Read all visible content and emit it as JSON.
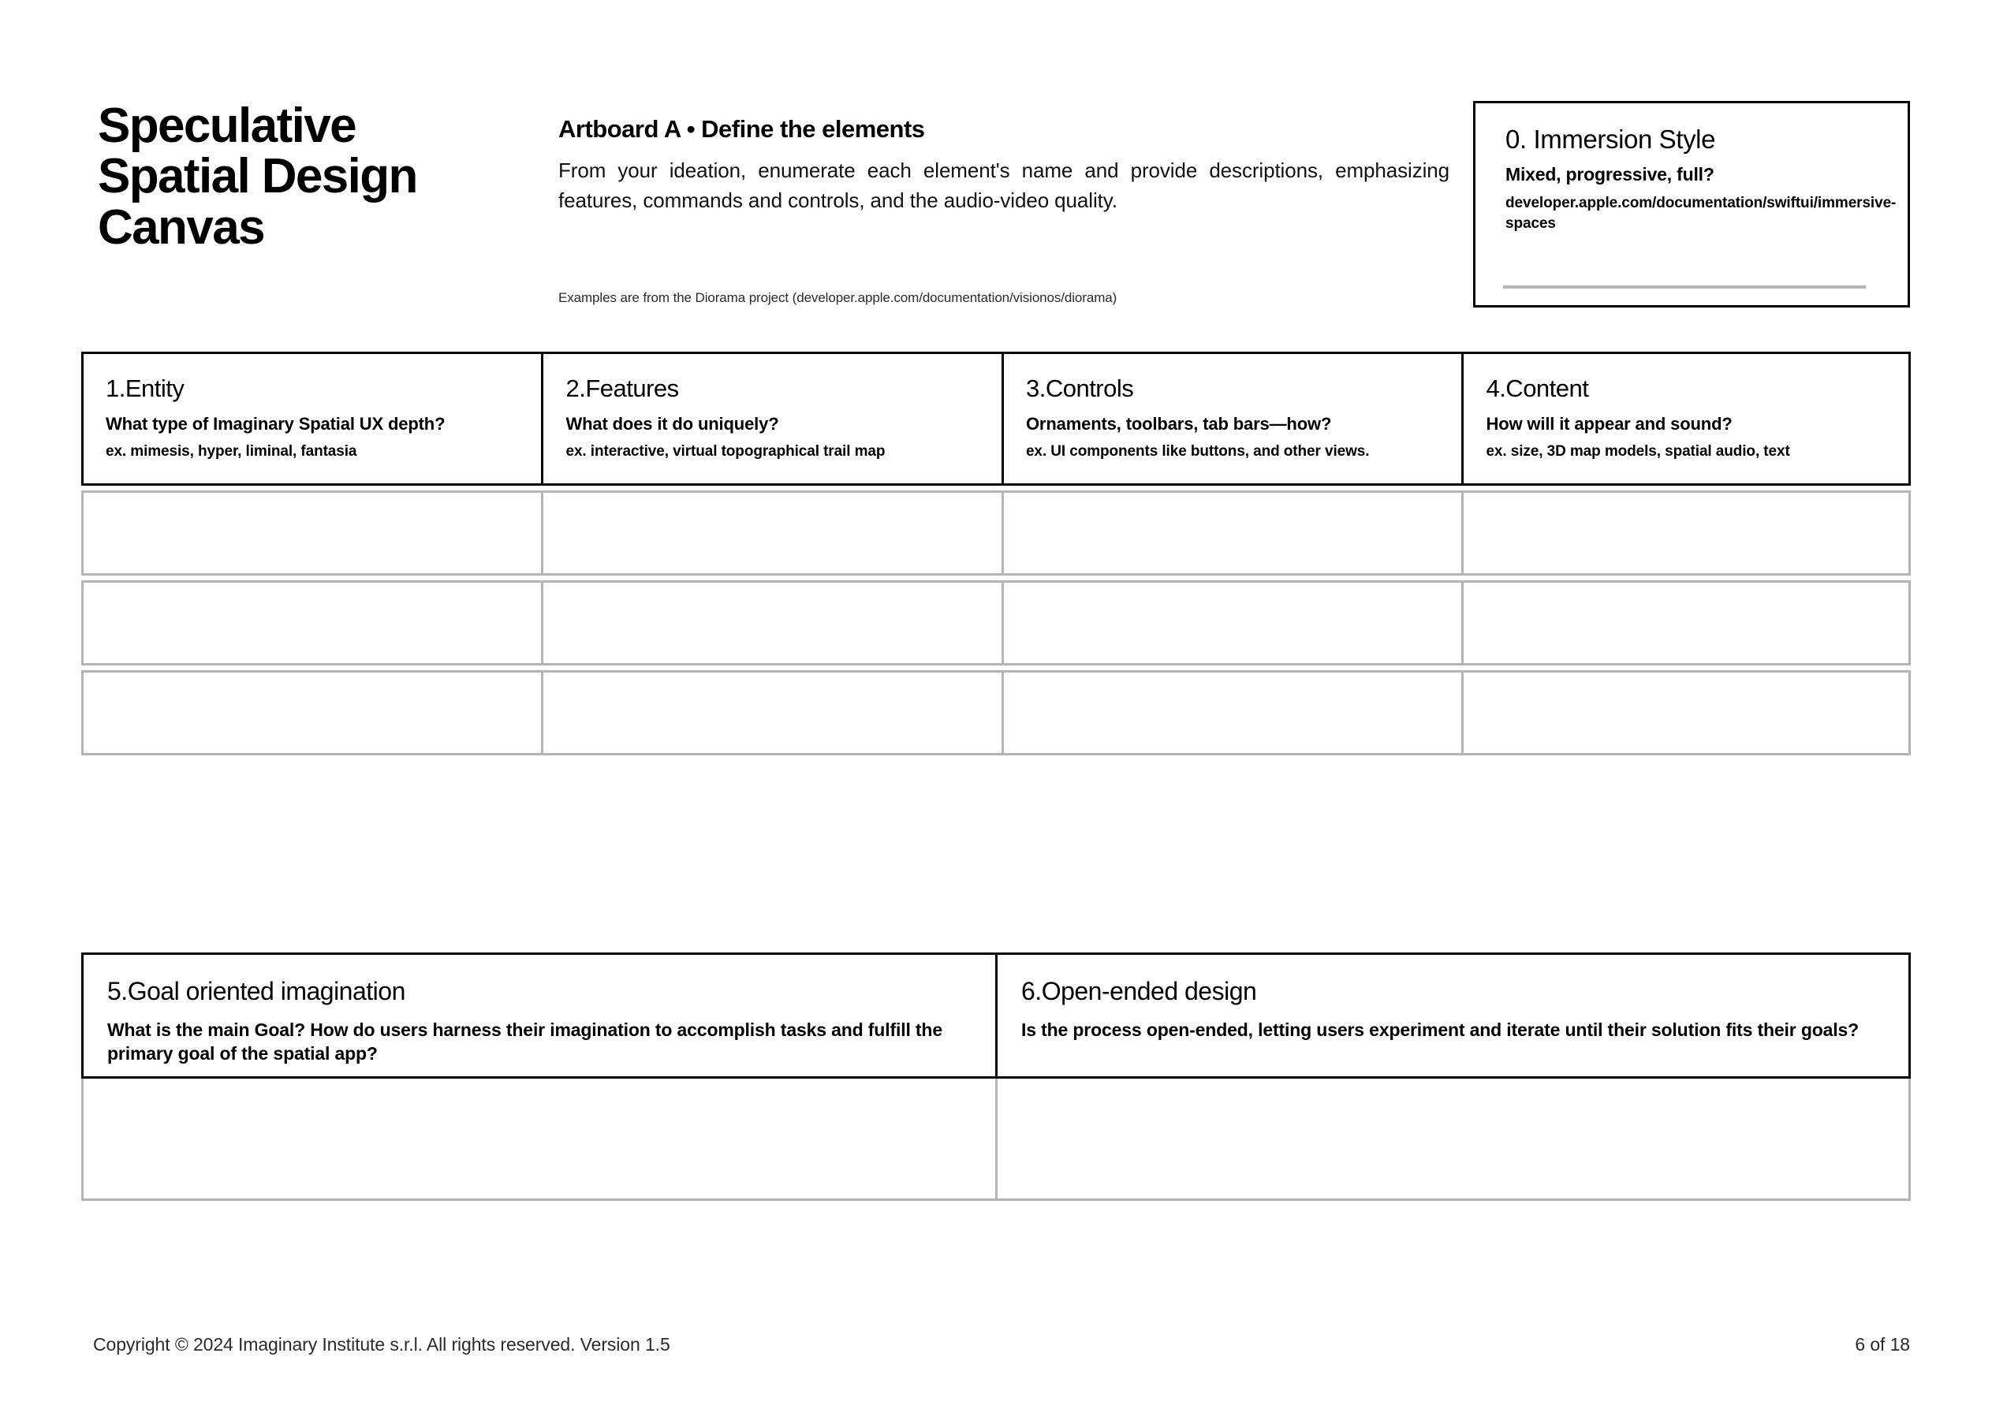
{
  "document": {
    "title_lines": [
      "Speculative",
      "Spatial Design",
      "Canvas"
    ]
  },
  "artboard": {
    "title": "Artboard A • Define the elements",
    "description": "From your ideation, enumerate each element's name and provide descriptions, emphasizing features, commands and controls, and the audio-video quality.",
    "note": "Examples are from the Diorama project (developer.apple.com/documentation/visionos/diorama)"
  },
  "immersion": {
    "title": "0. Immersion Style",
    "subtitle": "Mixed, progressive, full?",
    "url": "developer.apple.com/documentation/swiftui/immersive-spaces"
  },
  "grid": {
    "columns": [
      {
        "title": "1.Entity",
        "question": "What type of Imaginary Spatial UX depth?",
        "example": "ex. mimesis, hyper, liminal, fantasia"
      },
      {
        "title": "2.Features",
        "question": "What does it do uniquely?",
        "example": "ex. interactive, virtual topographical trail map"
      },
      {
        "title": "3.Controls",
        "question": "Ornaments, toolbars, tab bars—how?",
        "example": "ex. UI components like buttons, and other views."
      },
      {
        "title": "4.Content",
        "question": "How will it appear and sound?",
        "example": "ex. size, 3D map models, spatial audio, text"
      }
    ],
    "empty_rows": 3,
    "cells": [
      [
        "",
        "",
        "",
        ""
      ],
      [
        "",
        "",
        "",
        ""
      ],
      [
        "",
        "",
        "",
        ""
      ]
    ]
  },
  "bottom_sections": [
    {
      "title": "5.Goal oriented imagination",
      "question": "What is the main Goal? How do users harness their imagination to accomplish tasks and fulfill the primary goal of the spatial app?",
      "answer": ""
    },
    {
      "title": "6.Open-ended design",
      "question": "Is the process open-ended, letting users experiment and iterate until their solution fits their goals?",
      "answer": ""
    }
  ],
  "footer": {
    "copyright": "Copyright © 2024 Imaginary Institute s.r.l. All rights reserved. Version 1.5",
    "page": "6 of 18"
  },
  "colors": {
    "ink": "#000000",
    "rule_gray": "#b4b4b4",
    "muted_text": "#2a2a2a"
  }
}
